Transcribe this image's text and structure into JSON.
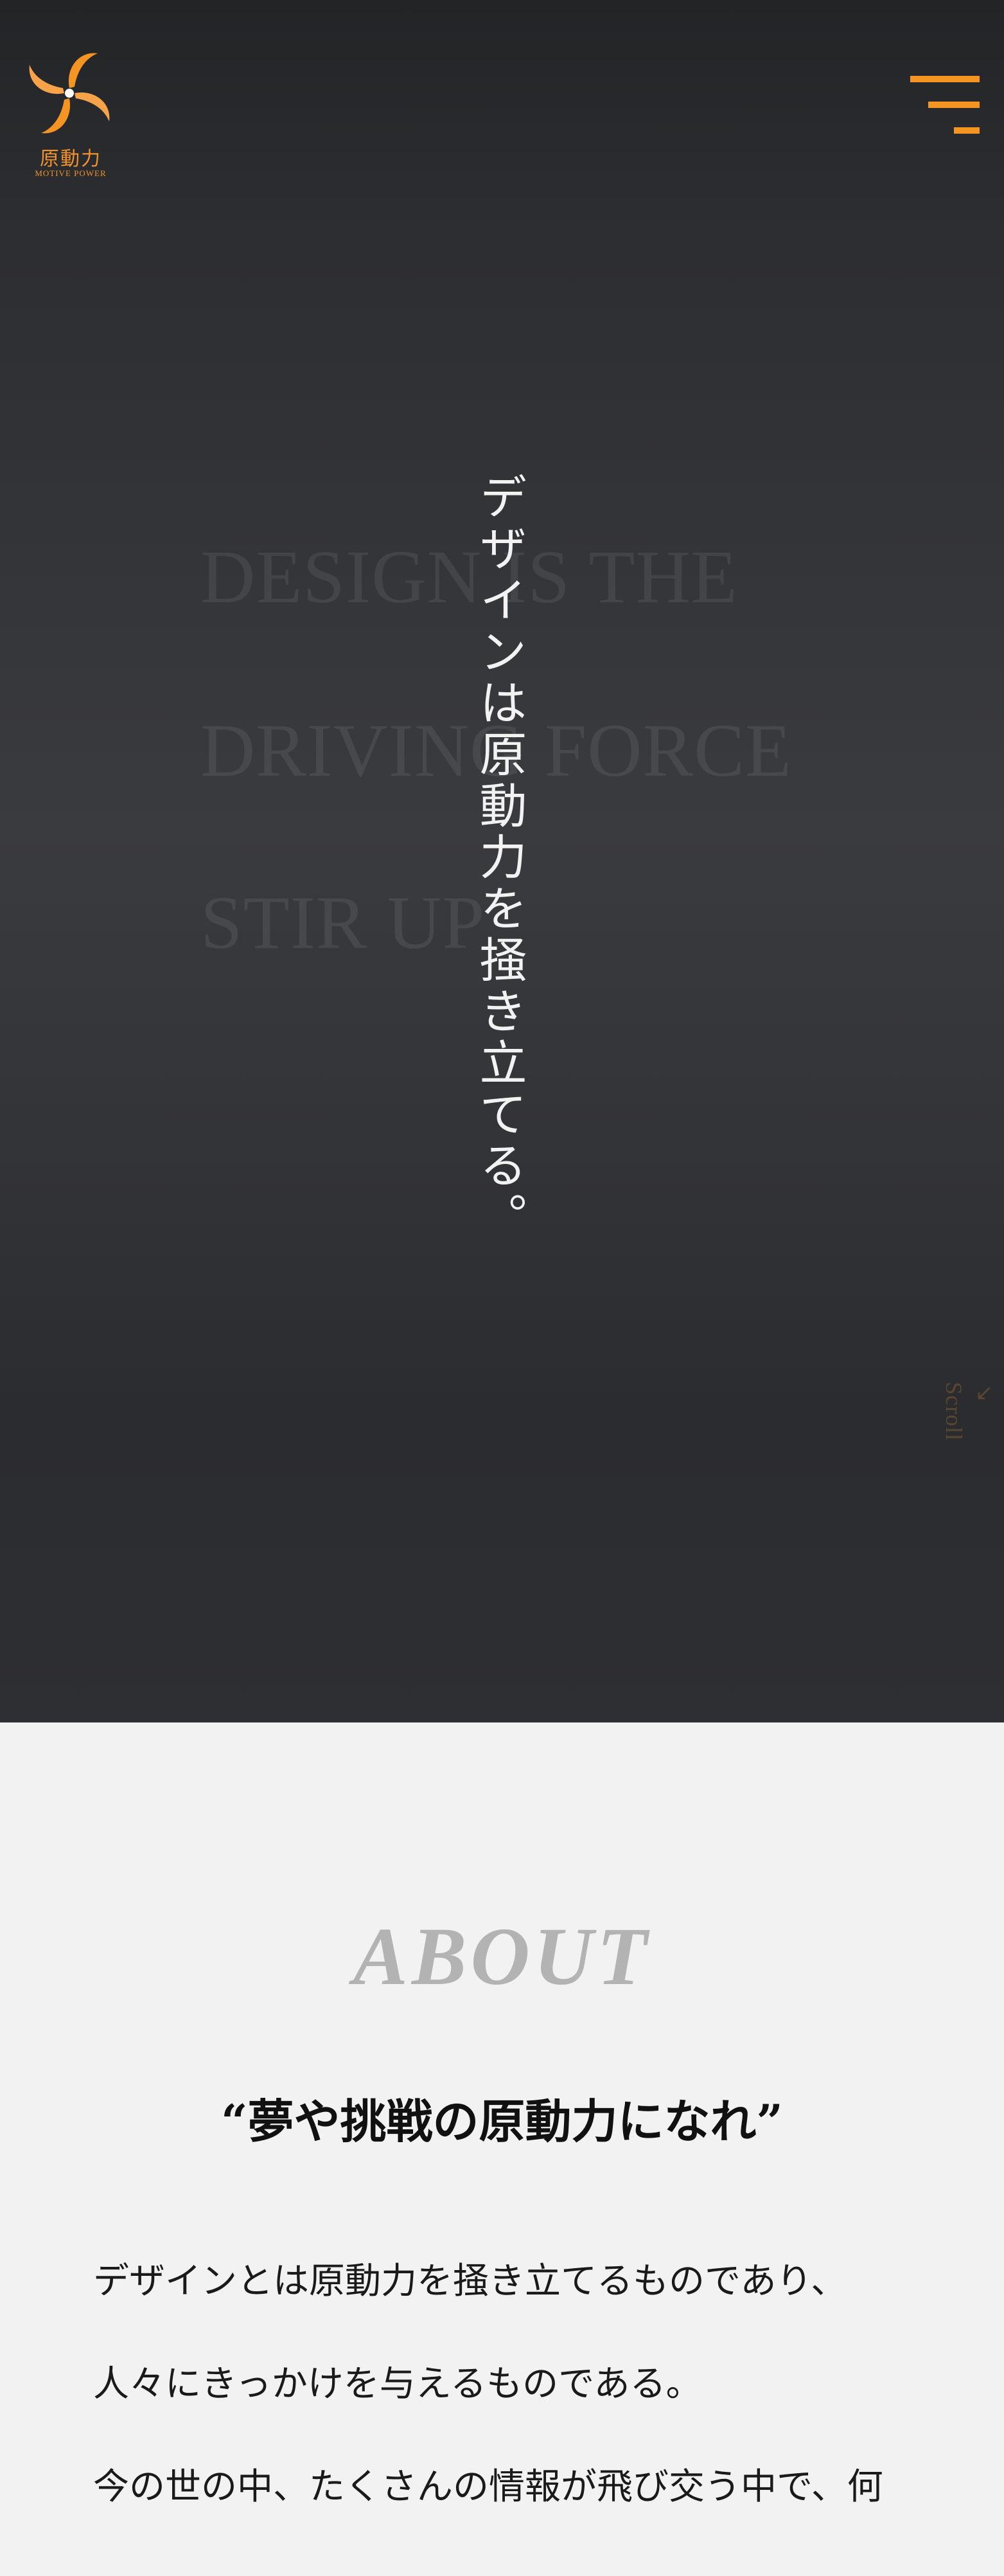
{
  "header": {
    "logo_text_jp": "原動力",
    "logo_text_en": "MOTIVE POWER",
    "logo_icon": "swirl-logo-icon",
    "menu_icon": "hamburger-menu-icon"
  },
  "hero": {
    "background_lines": [
      "DESIGN IS THE",
      "DRIVING FORCE",
      "STIR UP"
    ],
    "vertical_copy": "デザインは原動力を掻き立てる。",
    "scroll_label": "Scroll",
    "scroll_icon": "arrow-down-left-icon"
  },
  "about": {
    "heading": "ABOUT",
    "catch": "“夢や挑戦の原動力になれ”",
    "body": [
      "デザインとは原動力を掻き立てるものであり、",
      "人々にきっかけを与えるものである。",
      "今の世の中、たくさんの情報が飛び交う中で、何"
    ]
  },
  "colors": {
    "accent": "#f39423",
    "hero_background": "#35363a",
    "about_background": "#f2f2f2",
    "heading_gray": "#b3b3b3"
  }
}
